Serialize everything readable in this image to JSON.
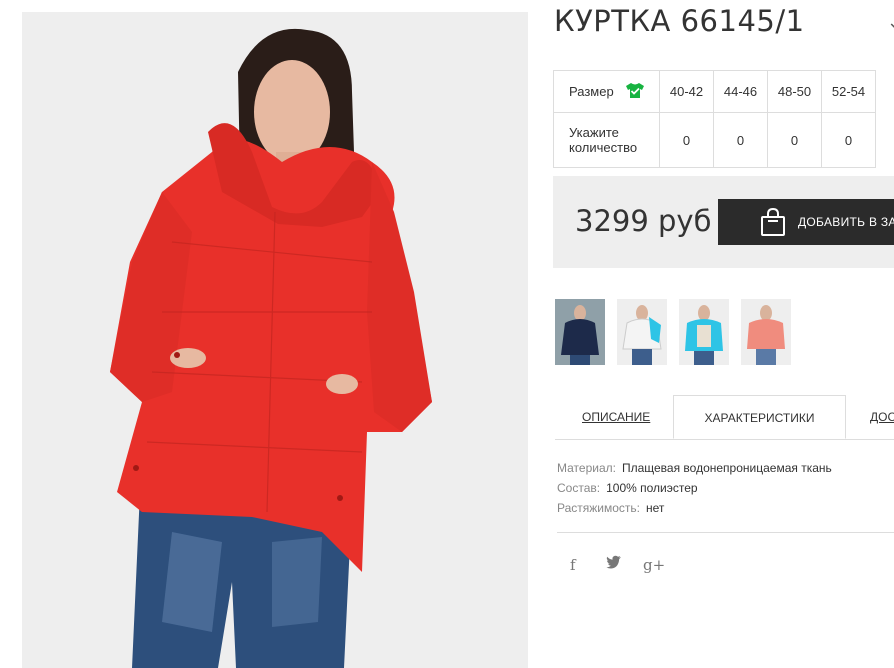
{
  "product": {
    "title": "КУРТКА 66145/1"
  },
  "size_table": {
    "size_label": "Размер",
    "sizes": [
      "40-42",
      "44-46",
      "48-50",
      "52-54"
    ],
    "quantity_label": "Укажите количество",
    "quantities": [
      "0",
      "0",
      "0",
      "0"
    ]
  },
  "cart": {
    "price": "3299 руб",
    "add_button_label": "ДОБАВИТЬ В ЗА"
  },
  "tabs": {
    "description": "ОПИСАНИЕ",
    "characteristics": "ХАРАКТЕРИСТИКИ",
    "delivery": "ДОС"
  },
  "specs": {
    "material_key": "Материал:",
    "material_val": "Плащевая водонепроницаемая ткань",
    "composition_key": "Состав:",
    "composition_val": "100% полиэстер",
    "stretch_key": "Растяжимость:",
    "stretch_val": "нет"
  },
  "social": {
    "facebook": "f",
    "twitter": "🐦",
    "googleplus": "g+"
  },
  "colors": {
    "jacket_red": "#e8302a",
    "dark_button": "#2b2b2b",
    "check_green": "#17b341"
  },
  "icons": [
    "shirt-check-icon",
    "shopping-bag-icon",
    "facebook-icon",
    "twitter-icon",
    "google-plus-icon"
  ]
}
